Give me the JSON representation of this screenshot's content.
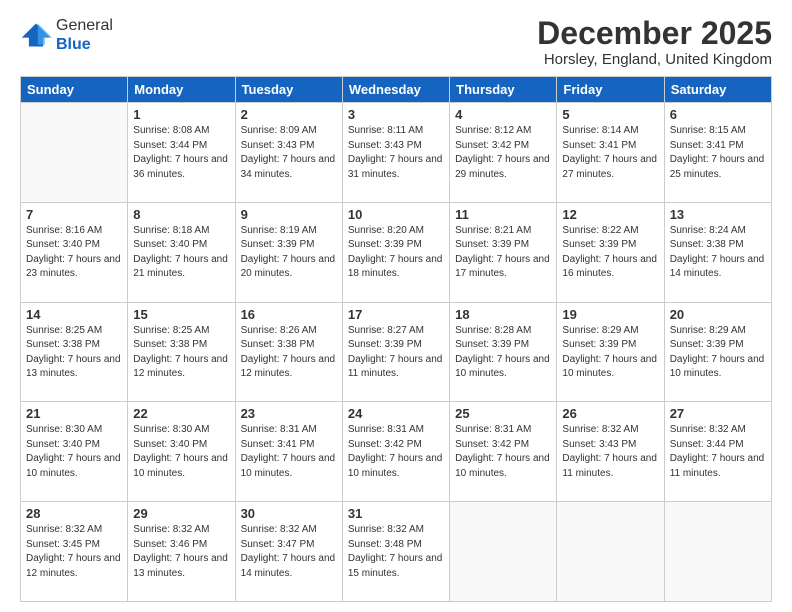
{
  "logo": {
    "general": "General",
    "blue": "Blue"
  },
  "header": {
    "month": "December 2025",
    "location": "Horsley, England, United Kingdom"
  },
  "days_of_week": [
    "Sunday",
    "Monday",
    "Tuesday",
    "Wednesday",
    "Thursday",
    "Friday",
    "Saturday"
  ],
  "weeks": [
    [
      {
        "day": "",
        "info": ""
      },
      {
        "day": "1",
        "info": "Sunrise: 8:08 AM\nSunset: 3:44 PM\nDaylight: 7 hours\nand 36 minutes."
      },
      {
        "day": "2",
        "info": "Sunrise: 8:09 AM\nSunset: 3:43 PM\nDaylight: 7 hours\nand 34 minutes."
      },
      {
        "day": "3",
        "info": "Sunrise: 8:11 AM\nSunset: 3:43 PM\nDaylight: 7 hours\nand 31 minutes."
      },
      {
        "day": "4",
        "info": "Sunrise: 8:12 AM\nSunset: 3:42 PM\nDaylight: 7 hours\nand 29 minutes."
      },
      {
        "day": "5",
        "info": "Sunrise: 8:14 AM\nSunset: 3:41 PM\nDaylight: 7 hours\nand 27 minutes."
      },
      {
        "day": "6",
        "info": "Sunrise: 8:15 AM\nSunset: 3:41 PM\nDaylight: 7 hours\nand 25 minutes."
      }
    ],
    [
      {
        "day": "7",
        "info": "Sunrise: 8:16 AM\nSunset: 3:40 PM\nDaylight: 7 hours\nand 23 minutes."
      },
      {
        "day": "8",
        "info": "Sunrise: 8:18 AM\nSunset: 3:40 PM\nDaylight: 7 hours\nand 21 minutes."
      },
      {
        "day": "9",
        "info": "Sunrise: 8:19 AM\nSunset: 3:39 PM\nDaylight: 7 hours\nand 20 minutes."
      },
      {
        "day": "10",
        "info": "Sunrise: 8:20 AM\nSunset: 3:39 PM\nDaylight: 7 hours\nand 18 minutes."
      },
      {
        "day": "11",
        "info": "Sunrise: 8:21 AM\nSunset: 3:39 PM\nDaylight: 7 hours\nand 17 minutes."
      },
      {
        "day": "12",
        "info": "Sunrise: 8:22 AM\nSunset: 3:39 PM\nDaylight: 7 hours\nand 16 minutes."
      },
      {
        "day": "13",
        "info": "Sunrise: 8:24 AM\nSunset: 3:38 PM\nDaylight: 7 hours\nand 14 minutes."
      }
    ],
    [
      {
        "day": "14",
        "info": "Sunrise: 8:25 AM\nSunset: 3:38 PM\nDaylight: 7 hours\nand 13 minutes."
      },
      {
        "day": "15",
        "info": "Sunrise: 8:25 AM\nSunset: 3:38 PM\nDaylight: 7 hours\nand 12 minutes."
      },
      {
        "day": "16",
        "info": "Sunrise: 8:26 AM\nSunset: 3:38 PM\nDaylight: 7 hours\nand 12 minutes."
      },
      {
        "day": "17",
        "info": "Sunrise: 8:27 AM\nSunset: 3:39 PM\nDaylight: 7 hours\nand 11 minutes."
      },
      {
        "day": "18",
        "info": "Sunrise: 8:28 AM\nSunset: 3:39 PM\nDaylight: 7 hours\nand 10 minutes."
      },
      {
        "day": "19",
        "info": "Sunrise: 8:29 AM\nSunset: 3:39 PM\nDaylight: 7 hours\nand 10 minutes."
      },
      {
        "day": "20",
        "info": "Sunrise: 8:29 AM\nSunset: 3:39 PM\nDaylight: 7 hours\nand 10 minutes."
      }
    ],
    [
      {
        "day": "21",
        "info": "Sunrise: 8:30 AM\nSunset: 3:40 PM\nDaylight: 7 hours\nand 10 minutes."
      },
      {
        "day": "22",
        "info": "Sunrise: 8:30 AM\nSunset: 3:40 PM\nDaylight: 7 hours\nand 10 minutes."
      },
      {
        "day": "23",
        "info": "Sunrise: 8:31 AM\nSunset: 3:41 PM\nDaylight: 7 hours\nand 10 minutes."
      },
      {
        "day": "24",
        "info": "Sunrise: 8:31 AM\nSunset: 3:42 PM\nDaylight: 7 hours\nand 10 minutes."
      },
      {
        "day": "25",
        "info": "Sunrise: 8:31 AM\nSunset: 3:42 PM\nDaylight: 7 hours\nand 10 minutes."
      },
      {
        "day": "26",
        "info": "Sunrise: 8:32 AM\nSunset: 3:43 PM\nDaylight: 7 hours\nand 11 minutes."
      },
      {
        "day": "27",
        "info": "Sunrise: 8:32 AM\nSunset: 3:44 PM\nDaylight: 7 hours\nand 11 minutes."
      }
    ],
    [
      {
        "day": "28",
        "info": "Sunrise: 8:32 AM\nSunset: 3:45 PM\nDaylight: 7 hours\nand 12 minutes."
      },
      {
        "day": "29",
        "info": "Sunrise: 8:32 AM\nSunset: 3:46 PM\nDaylight: 7 hours\nand 13 minutes."
      },
      {
        "day": "30",
        "info": "Sunrise: 8:32 AM\nSunset: 3:47 PM\nDaylight: 7 hours\nand 14 minutes."
      },
      {
        "day": "31",
        "info": "Sunrise: 8:32 AM\nSunset: 3:48 PM\nDaylight: 7 hours\nand 15 minutes."
      },
      {
        "day": "",
        "info": ""
      },
      {
        "day": "",
        "info": ""
      },
      {
        "day": "",
        "info": ""
      }
    ]
  ]
}
